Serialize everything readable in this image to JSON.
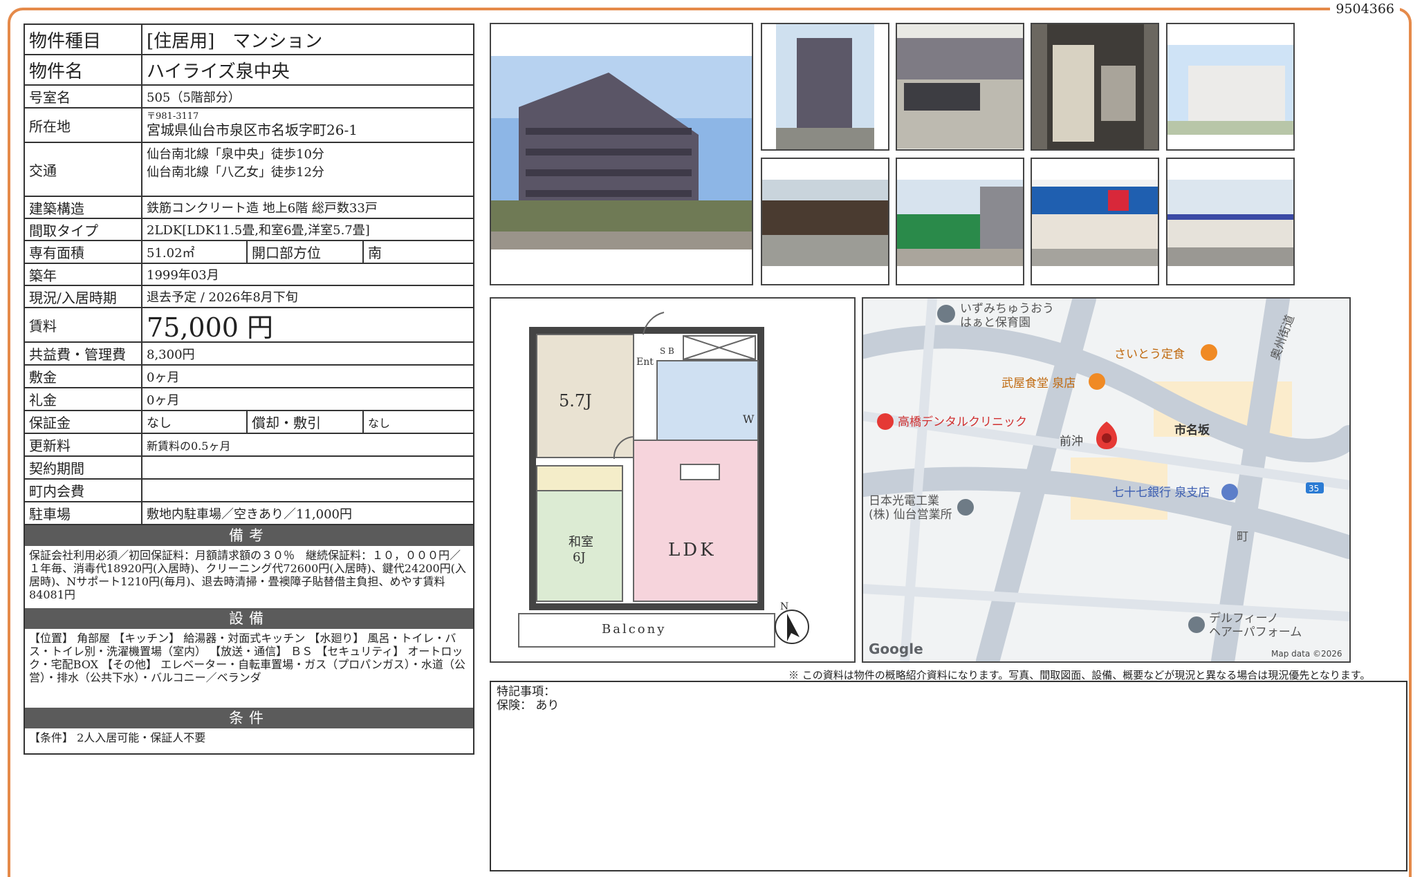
{
  "doc_number": "9504366",
  "spec": {
    "type_label": "物件種目",
    "type_value": "[住居用]　マンション",
    "name_label": "物件名",
    "name_value": "ハイライズ泉中央",
    "room_label": "号室名",
    "room_value": "505（5階部分）",
    "address_label": "所在地",
    "address_zip": "〒981-3117",
    "address_value": "宮城県仙台市泉区市名坂字町26-1",
    "transit_label": "交通",
    "transit_line1": "仙台南北線「泉中央」徒歩10分",
    "transit_line2": "仙台南北線「八乙女」徒歩12分",
    "structure_label": "建築構造",
    "structure_value": "鉄筋コンクリート造 地上6階 総戸数33戸",
    "layout_label": "間取タイプ",
    "layout_value": "2LDK[LDK11.5畳,和室6畳,洋室5.7畳]",
    "area_label": "専有面積",
    "area_value": "51.02㎡",
    "direction_label": "開口部方位",
    "direction_value": "南",
    "built_label": "築年",
    "built_value": "1999年03月",
    "status_label": "現況/入居時期",
    "status_value": "退去予定 / 2026年8月下旬",
    "rent_label": "賃料",
    "rent_value": "75,000 円",
    "fee_label": "共益費・管理費",
    "fee_value": "8,300円",
    "deposit_label": "敷金",
    "deposit_value": "0ヶ月",
    "keymoney_label": "礼金",
    "keymoney_value": "0ヶ月",
    "guarantee_label": "保証金",
    "guarantee_value": "なし",
    "amort_label": "償却・敷引",
    "amort_value": "なし",
    "renewal_label": "更新料",
    "renewal_value": "新賃料の0.5ヶ月",
    "contract_label": "契約期間",
    "contract_value": "",
    "community_label": "町内会費",
    "community_value": "",
    "parking_label": "駐車場",
    "parking_value": "敷地内駐車場／空きあり／11,000円"
  },
  "remarks_band": "備考",
  "remarks_text": "保証会社利用必須／初回保証料：月額請求額の３０％　継続保証料：１０，０００円／１年毎、消毒代18920円(入居時)、クリーニング代72600円(入居時)、鍵代24200円(入居時)、Nサポート1210円(毎月)、退去時清掃・畳襖障子貼替借主負担、めやす賃料84081円",
  "equip_band": "設備",
  "equip_text": "【位置】 角部屋 【キッチン】 給湯器・対面式キッチン 【水廻り】 風呂・トイレ・バス・トイレ別・洗濯機置場（室内） 【放送・通信】 ＢＳ 【セキュリティ】 オートロック・宅配BOX 【その他】 エレベーター・自転車置場・ガス（プロパンガス）・水道（公営）・排水（公共下水）・バルコニー／ベランダ",
  "cond_band": "条件",
  "cond_text": "【条件】 2人入居可能・保証人不要",
  "floorplan": {
    "room1": "5.7J",
    "room2_a": "和室",
    "room2_b": "6J",
    "ldk": "LDK",
    "balcony": "Balcony",
    "ent": "Ent",
    "sb": "S B",
    "w": "W",
    "north": "N"
  },
  "map": {
    "poi1": "いずみちゅうおう",
    "poi1b": "はぁと保育園",
    "poi2": "さいとう定食",
    "poi3": "武屋食堂 泉店",
    "poi4": "高橋デンタルクリニック",
    "poi5": "市名坂",
    "poi6": "前沖",
    "poi7": "七十七銀行 泉支店",
    "poi8": "日本光電工業",
    "poi8b": "(株) 仙台営業所",
    "poi9": "町",
    "poi10": "デルフィーノ",
    "poi10b": "ヘアーパフォーム",
    "road": "奥州街道",
    "route": "35",
    "logo": "Google",
    "attrib": "Map data ©2026"
  },
  "disclaimer": "※ この資料は物件の概略紹介資料になります。写真、間取図面、設備、概要などが現況と異なる場合は現況優先となります。",
  "special_label": "特記事項：",
  "insurance": "保険： あり",
  "colors": {
    "frame": "#e58a4a",
    "band": "#5b5b5b",
    "ldk_fill": "#f6d4dc",
    "washitsu_fill": "#dcebd3",
    "room1_fill": "#e9e2d2",
    "bath_fill": "#cfe0f2"
  }
}
